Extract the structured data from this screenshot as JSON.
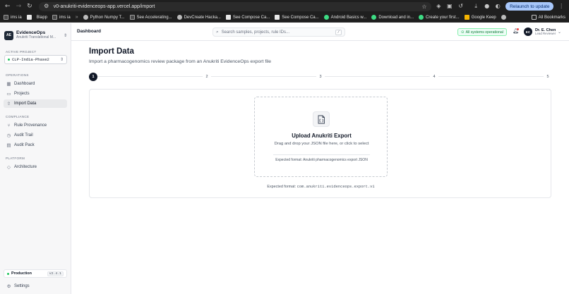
{
  "browser": {
    "url": "v0-anukriti-evidenceops-app.vercel.app/import",
    "relaunch_label": "Relaunch to update",
    "bookmarks": [
      {
        "label": "ims ia",
        "icon": "dark"
      },
      {
        "label": "",
        "icon": "white"
      },
      {
        "label": "Blapp",
        "icon": "white"
      },
      {
        "label": "ims ia",
        "icon": "dark"
      },
      {
        "label": "Python Numpy T...",
        "icon": "grey-circle"
      },
      {
        "label": "See Accelerating...",
        "icon": "dark"
      },
      {
        "label": "DevCreate Hacka...",
        "icon": "grey-circle"
      },
      {
        "label": "See Compose Ca...",
        "icon": "white"
      },
      {
        "label": "See Compose Ca...",
        "icon": "white"
      },
      {
        "label": "Android Basics w...",
        "icon": "green"
      },
      {
        "label": "Download and in...",
        "icon": "green"
      },
      {
        "label": "Create your first...",
        "icon": "green"
      },
      {
        "label": "Google Keep",
        "icon": "yellow"
      }
    ],
    "all_bookmarks_label": "All Bookmarks"
  },
  "sidebar": {
    "org_logo": "AE",
    "org_name": "EvidenceOps",
    "org_sub": "Anukriti Translational M...",
    "active_project_label": "ACTIVE PROJECT",
    "project_name": "CLP-India-Phase2",
    "sections": {
      "operations": "OPERATIONS",
      "compliance": "COMPLIANCE",
      "platform": "PLATFORM"
    },
    "items": {
      "dashboard": "Dashboard",
      "projects": "Projects",
      "import": "Import Data",
      "rule_provenance": "Rule Provenance",
      "audit_trail": "Audit Trail",
      "audit_pack": "Audit Pack",
      "architecture": "Architecture",
      "settings": "Settings"
    },
    "environment": "Production",
    "version": "v2.4.1"
  },
  "header": {
    "breadcrumb": "Dashboard",
    "search_placeholder": "Search samples, projects, rule IDs...",
    "search_shortcut": "/",
    "status": "All systems operational",
    "user_initials": "EC",
    "user_name": "Dr. E. Chen",
    "user_role": "Lead Reviewer"
  },
  "page": {
    "title": "Import Data",
    "subtitle": "Import a pharmacogenomics review package from an Anukriti EvidenceOps export file",
    "steps": [
      "1",
      "2",
      "3",
      "4",
      "5"
    ],
    "active_step": 1,
    "upload_title": "Upload Anukriti Export",
    "upload_sub": "Drag and drop your JSON file here, or click to select",
    "upload_format": "Expected format: Anukriti pharmacogenomics export JSON",
    "footer_prefix": "Expected format: ",
    "footer_code": "com.anukriti.evidenceops.export.v1"
  },
  "colors": {
    "accent": "#111827",
    "status_green": "#16a34a",
    "relaunch": "#a8c7fa"
  }
}
